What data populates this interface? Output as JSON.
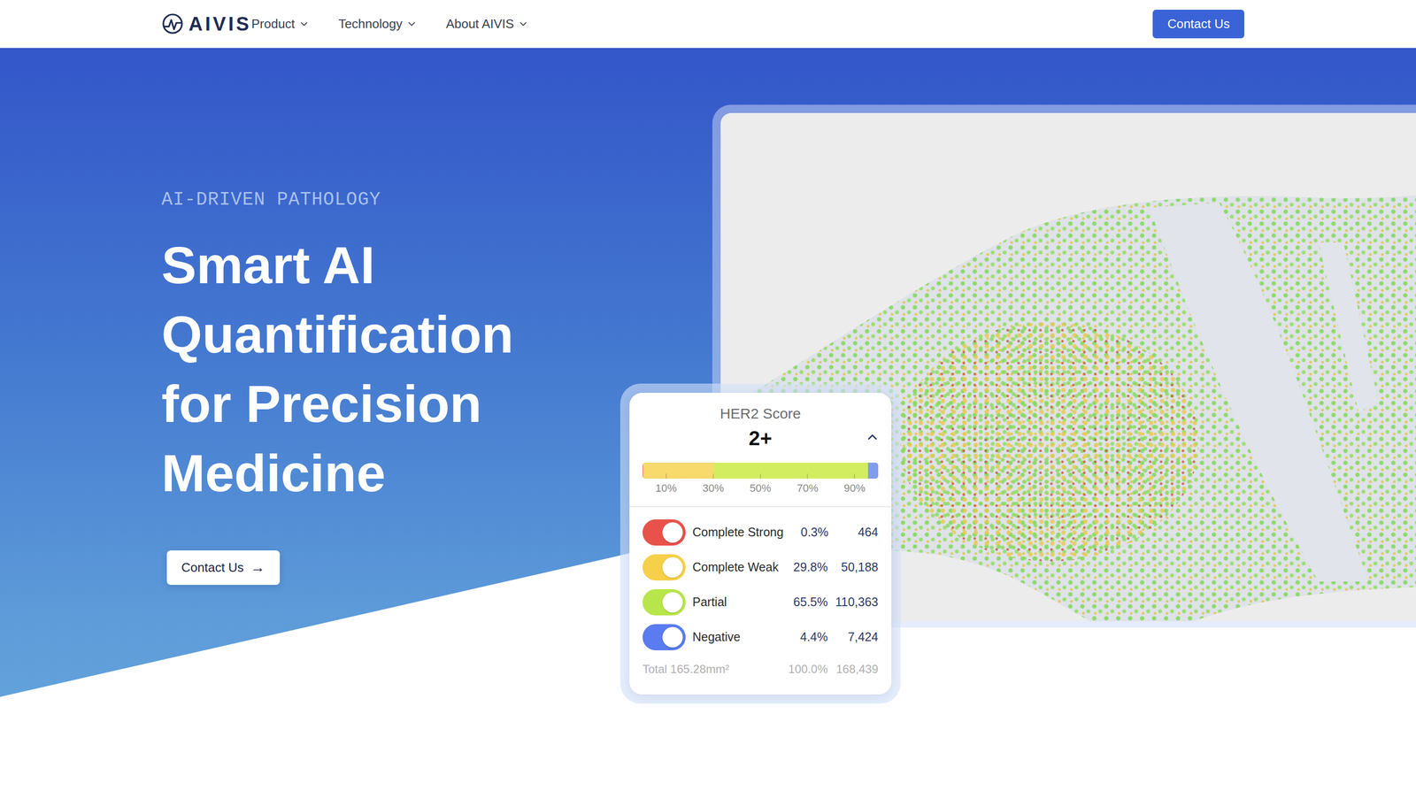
{
  "nav": {
    "logo": "AIVIS",
    "items": [
      {
        "label": "Product"
      },
      {
        "label": "Technology"
      },
      {
        "label": "About AIVIS"
      }
    ],
    "cta": "Contact Us"
  },
  "hero": {
    "eyebrow": "AI-DRIVEN PATHOLOGY",
    "title_lines": [
      "Smart AI",
      "Quantification",
      "for Precision",
      "Medicine"
    ],
    "cta": "Contact Us",
    "cta_arrow": "→"
  },
  "score_card": {
    "title": "HER2 Score",
    "value": "2+",
    "expanded": true,
    "bar": {
      "segments": [
        {
          "level": 0.003,
          "color": "#e8524a"
        },
        {
          "level": 0.298,
          "color": "#f8d96c"
        },
        {
          "level": 0.655,
          "color": "#d3ed61"
        },
        {
          "level": 0.044,
          "color": "#7f9cf0"
        }
      ],
      "ticks": [
        "10%",
        "30%",
        "50%",
        "70%",
        "90%"
      ]
    },
    "rows": [
      {
        "label": "Complete Strong",
        "percent": "0.3%",
        "count": "464",
        "on": true,
        "color": "#e8524a"
      },
      {
        "label": "Complete Weak",
        "percent": "29.8%",
        "count": "50,188",
        "on": true,
        "color": "#f7d04a"
      },
      {
        "label": "Partial",
        "percent": "65.5%",
        "count": "110,363",
        "on": true,
        "color": "#b8e64a"
      },
      {
        "label": "Negative",
        "percent": "4.4%",
        "count": "7,424",
        "on": true,
        "color": "#5b7cf0"
      }
    ],
    "total": {
      "label": "Total 165.28mm²",
      "percent": "100.0%",
      "count": "168,439"
    }
  }
}
